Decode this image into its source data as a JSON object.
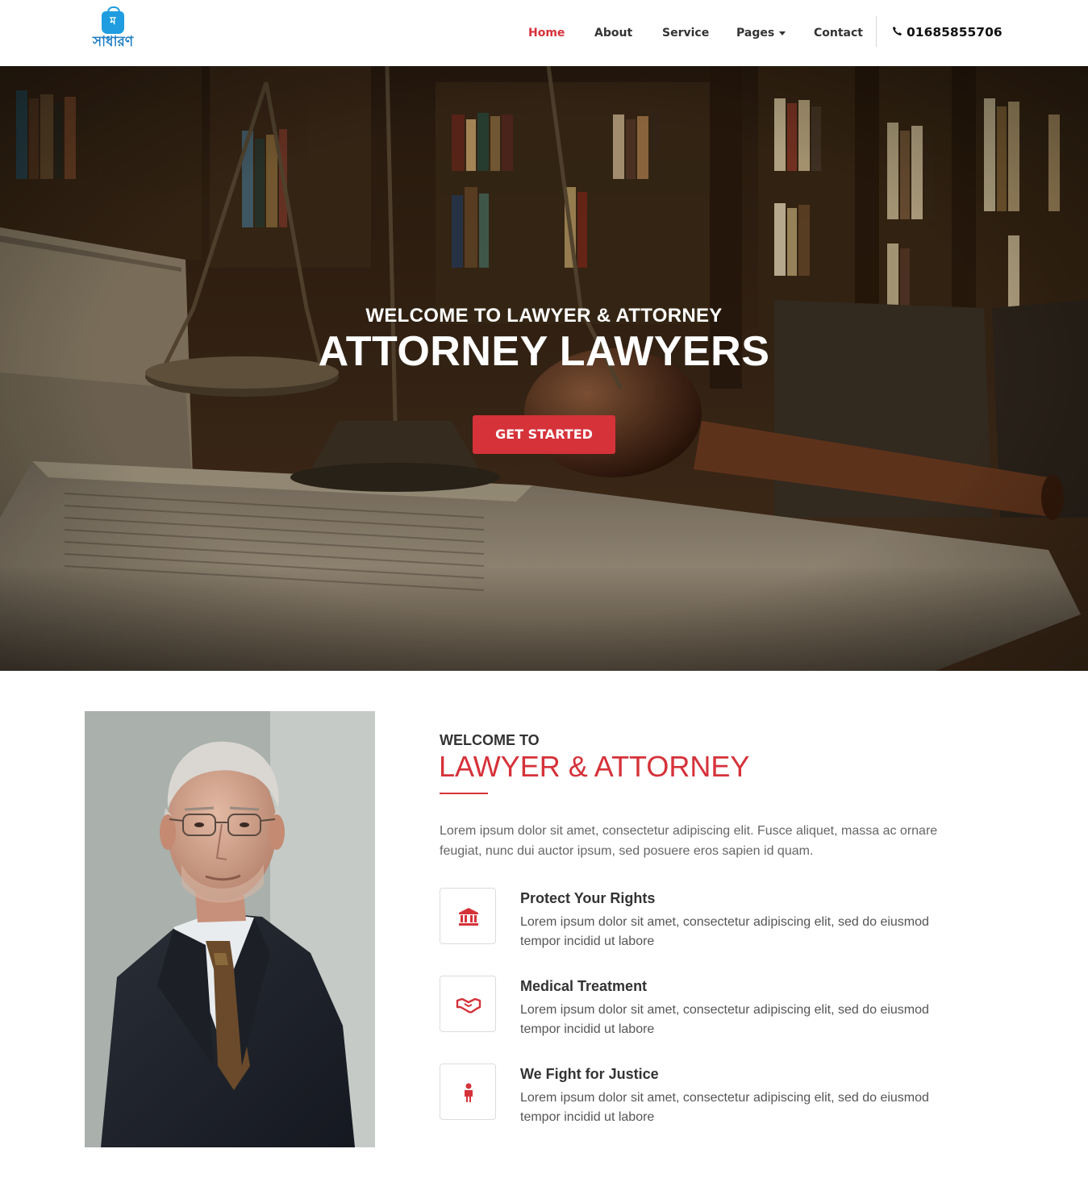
{
  "header": {
    "logo_glyph": "ম",
    "logo_text": "সাধারণ",
    "nav": [
      {
        "label": "Home",
        "active": true
      },
      {
        "label": "About"
      },
      {
        "label": "Service"
      },
      {
        "label": "Pages",
        "has_dropdown": true
      },
      {
        "label": "Contact"
      }
    ],
    "phone_icon": "phone-icon",
    "phone": "01685855706"
  },
  "hero": {
    "subtitle": "WELCOME TO LAWYER & ATTORNEY",
    "title": "ATTORNEY LAWYERS",
    "button": "GET STARTED"
  },
  "about": {
    "welcome_small": "WELCOME TO",
    "welcome_big": "LAWYER & ATTORNEY",
    "intro": "Lorem ipsum dolor sit amet, consectetur adipiscing elit. Fusce aliquet, massa ac ornare feugiat, nunc dui auctor ipsum, sed posuere eros sapien id quam.",
    "features": [
      {
        "icon": "bank-icon",
        "title": "Protect Your Rights",
        "text": "Lorem ipsum dolor sit amet, consectetur adipiscing elit, sed do eiusmod tempor incidid ut labore"
      },
      {
        "icon": "handshake-icon",
        "title": "Medical Treatment",
        "text": "Lorem ipsum dolor sit amet, consectetur adipiscing elit, sed do eiusmod tempor incidid ut labore"
      },
      {
        "icon": "person-icon",
        "title": "We Fight for Justice",
        "text": "Lorem ipsum dolor sit amet, consectetur adipiscing elit, sed do eiusmod tempor incidid ut labore"
      }
    ]
  },
  "colors": {
    "accent": "#d6323a",
    "brand_blue": "#1f9de0"
  }
}
